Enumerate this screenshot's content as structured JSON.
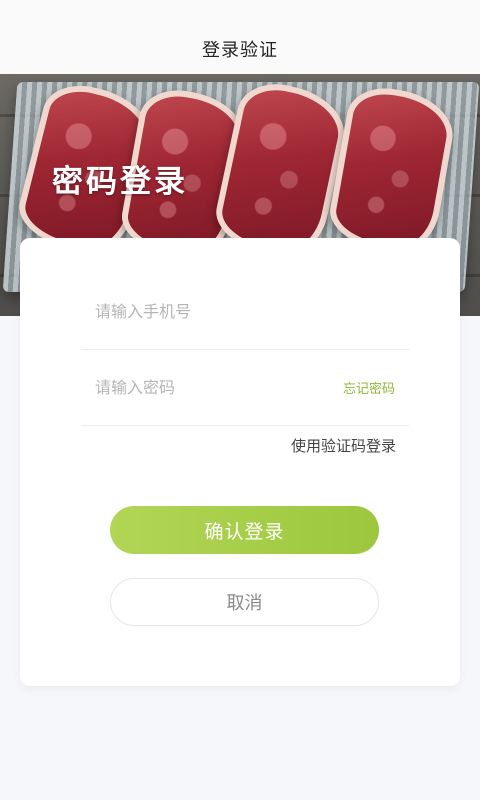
{
  "header": {
    "title": "登录验证"
  },
  "hero": {
    "title": "密码登录"
  },
  "form": {
    "phone_placeholder": "请输入手机号",
    "password_placeholder": "请输入密码",
    "forgot_password_label": "忘记密码",
    "sms_login_label": "使用验证码登录",
    "confirm_label": "确认登录",
    "cancel_label": "取消"
  },
  "colors": {
    "accent": "#9cc73d",
    "background": "#f6f7fb"
  }
}
